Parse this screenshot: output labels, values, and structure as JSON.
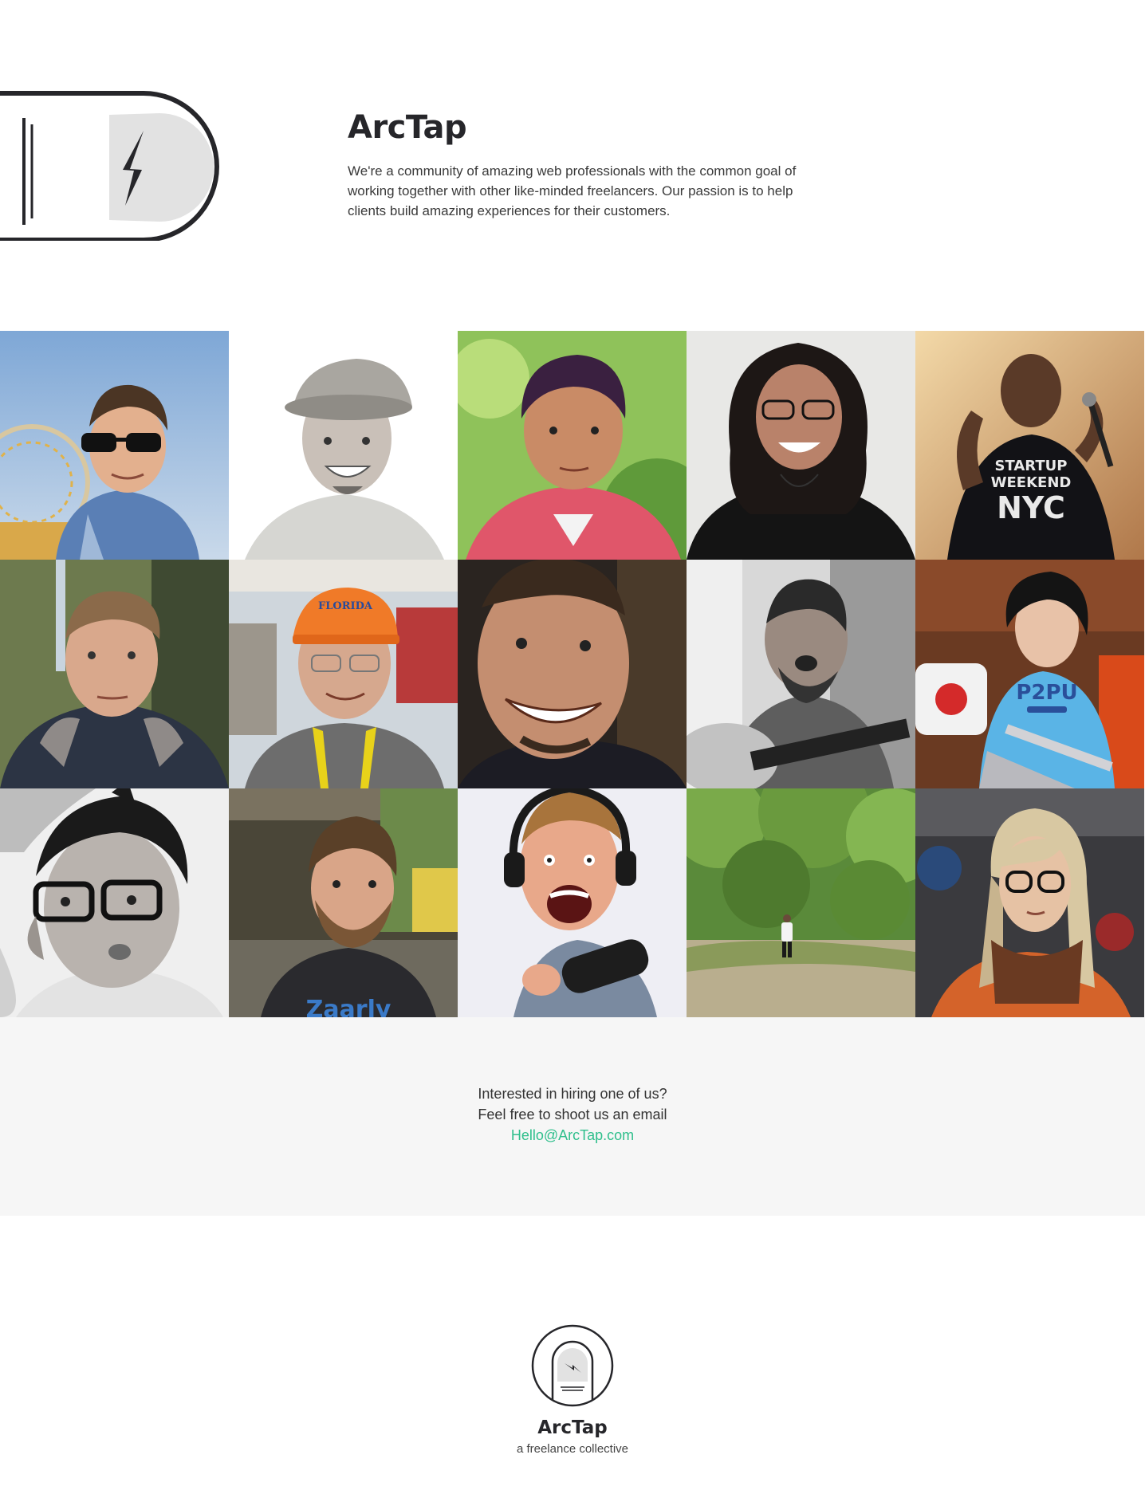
{
  "brand": {
    "name": "ArcTap",
    "accent_color": "#2fbf8c",
    "logo_icon": "lightning-bolt-icon"
  },
  "hero": {
    "title": "ArcTap",
    "description": "We're a community of amazing web professionals with the common goal of working together with other like-minded freelancers. Our passion is to help clients build amazing experiences for their customers."
  },
  "team": {
    "members": [
      {
        "photo": "man-sunglasses-ferris-wheel"
      },
      {
        "photo": "man-flat-cap-bw"
      },
      {
        "photo": "man-pink-shirt-green-bg"
      },
      {
        "photo": "woman-glasses-curly-hair"
      },
      {
        "photo": "man-microphone-startup-weekend"
      },
      {
        "photo": "man-hoodie-outdoors"
      },
      {
        "photo": "man-orange-florida-cap"
      },
      {
        "photo": "man-smiling-closeup"
      },
      {
        "photo": "man-guitar-singing-bw"
      },
      {
        "photo": "man-p2pu-shirt-laptop"
      },
      {
        "photo": "man-glasses-bw"
      },
      {
        "photo": "man-beard-porch"
      },
      {
        "photo": "man-headphones-microphone"
      },
      {
        "photo": "man-walking-forest"
      },
      {
        "photo": "woman-scarf-glasses"
      }
    ],
    "shirt_texts": {
      "startup": "STARTUP",
      "weekend": "WEEKEND",
      "nyc": "NYC",
      "p2pu": "P2PU",
      "zaarly": "Zaarly",
      "florida": "FLORIDA"
    }
  },
  "contact": {
    "line1": "Interested in hiring one of us?",
    "line2": "Feel free to shoot us an email",
    "email": "Hello@ArcTap.com"
  },
  "footer": {
    "title": "ArcTap",
    "tagline": "a freelance collective"
  }
}
